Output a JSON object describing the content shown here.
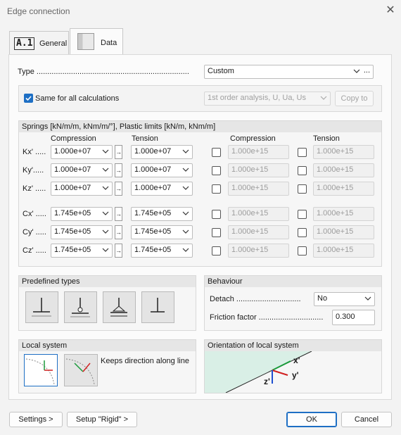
{
  "window": {
    "title": "Edge connection",
    "close_icon": "close-icon"
  },
  "tabs": [
    {
      "badge": "A.1",
      "label": "General"
    },
    {
      "label": "Data"
    }
  ],
  "type": {
    "label": "Type .......................................................................",
    "value": "Custom",
    "more": "..."
  },
  "same_for_all": {
    "label": "Same for all calculations",
    "checked": true,
    "analysis": "1st order analysis, U, Ua, Us",
    "copy_button": "Copy to"
  },
  "springs": {
    "header": "Springs [kN/m/m, kNm/m/°], Plastic limits [kN/m, kNm/m]",
    "col_compression": "Compression",
    "col_tension": "Tension",
    "col_limit_compression": "Compression",
    "col_limit_tension": "Tension",
    "rows": [
      {
        "label": "Kx' .....",
        "compression": "1.000e+07",
        "tension": "1.000e+07",
        "lim_c": "1.000e+15",
        "lim_t": "1.000e+15"
      },
      {
        "label": "Ky'.....",
        "compression": "1.000e+07",
        "tension": "1.000e+07",
        "lim_c": "1.000e+15",
        "lim_t": "1.000e+15"
      },
      {
        "label": "Kz' .....",
        "compression": "1.000e+07",
        "tension": "1.000e+07",
        "lim_c": "1.000e+15",
        "lim_t": "1.000e+15"
      },
      {
        "label": "Cx' .....",
        "compression": "1.745e+05",
        "tension": "1.745e+05",
        "lim_c": "1.000e+15",
        "lim_t": "1.000e+15"
      },
      {
        "label": "Cy' .....",
        "compression": "1.745e+05",
        "tension": "1.745e+05",
        "lim_c": "1.000e+15",
        "lim_t": "1.000e+15"
      },
      {
        "label": "Cz' .....",
        "compression": "1.745e+05",
        "tension": "1.745e+05",
        "lim_c": "1.000e+15",
        "lim_t": "1.000e+15"
      }
    ],
    "arrow": "→"
  },
  "predefined": {
    "header": "Predefined types"
  },
  "behaviour": {
    "header": "Behaviour",
    "detach_label": "Detach ..............................",
    "detach_value": "No",
    "friction_label": "Friction factor ..............................",
    "friction_value": "0.300"
  },
  "local_system": {
    "header": "Local system",
    "description": "Keeps direction along line"
  },
  "orientation": {
    "header": "Orientation of local system",
    "x_label": "x'",
    "y_label": "y'",
    "z_label": "z'"
  },
  "footer": {
    "settings": "Settings >",
    "setup_rigid": "Setup \"Rigid\" >",
    "ok": "OK",
    "cancel": "Cancel"
  },
  "colors": {
    "accent": "#1e6fc4",
    "axis_x": "#1a9a3a",
    "axis_y": "#d02020",
    "axis_z": "#1e4fd0",
    "orientation_bg": "#d9efe6"
  }
}
